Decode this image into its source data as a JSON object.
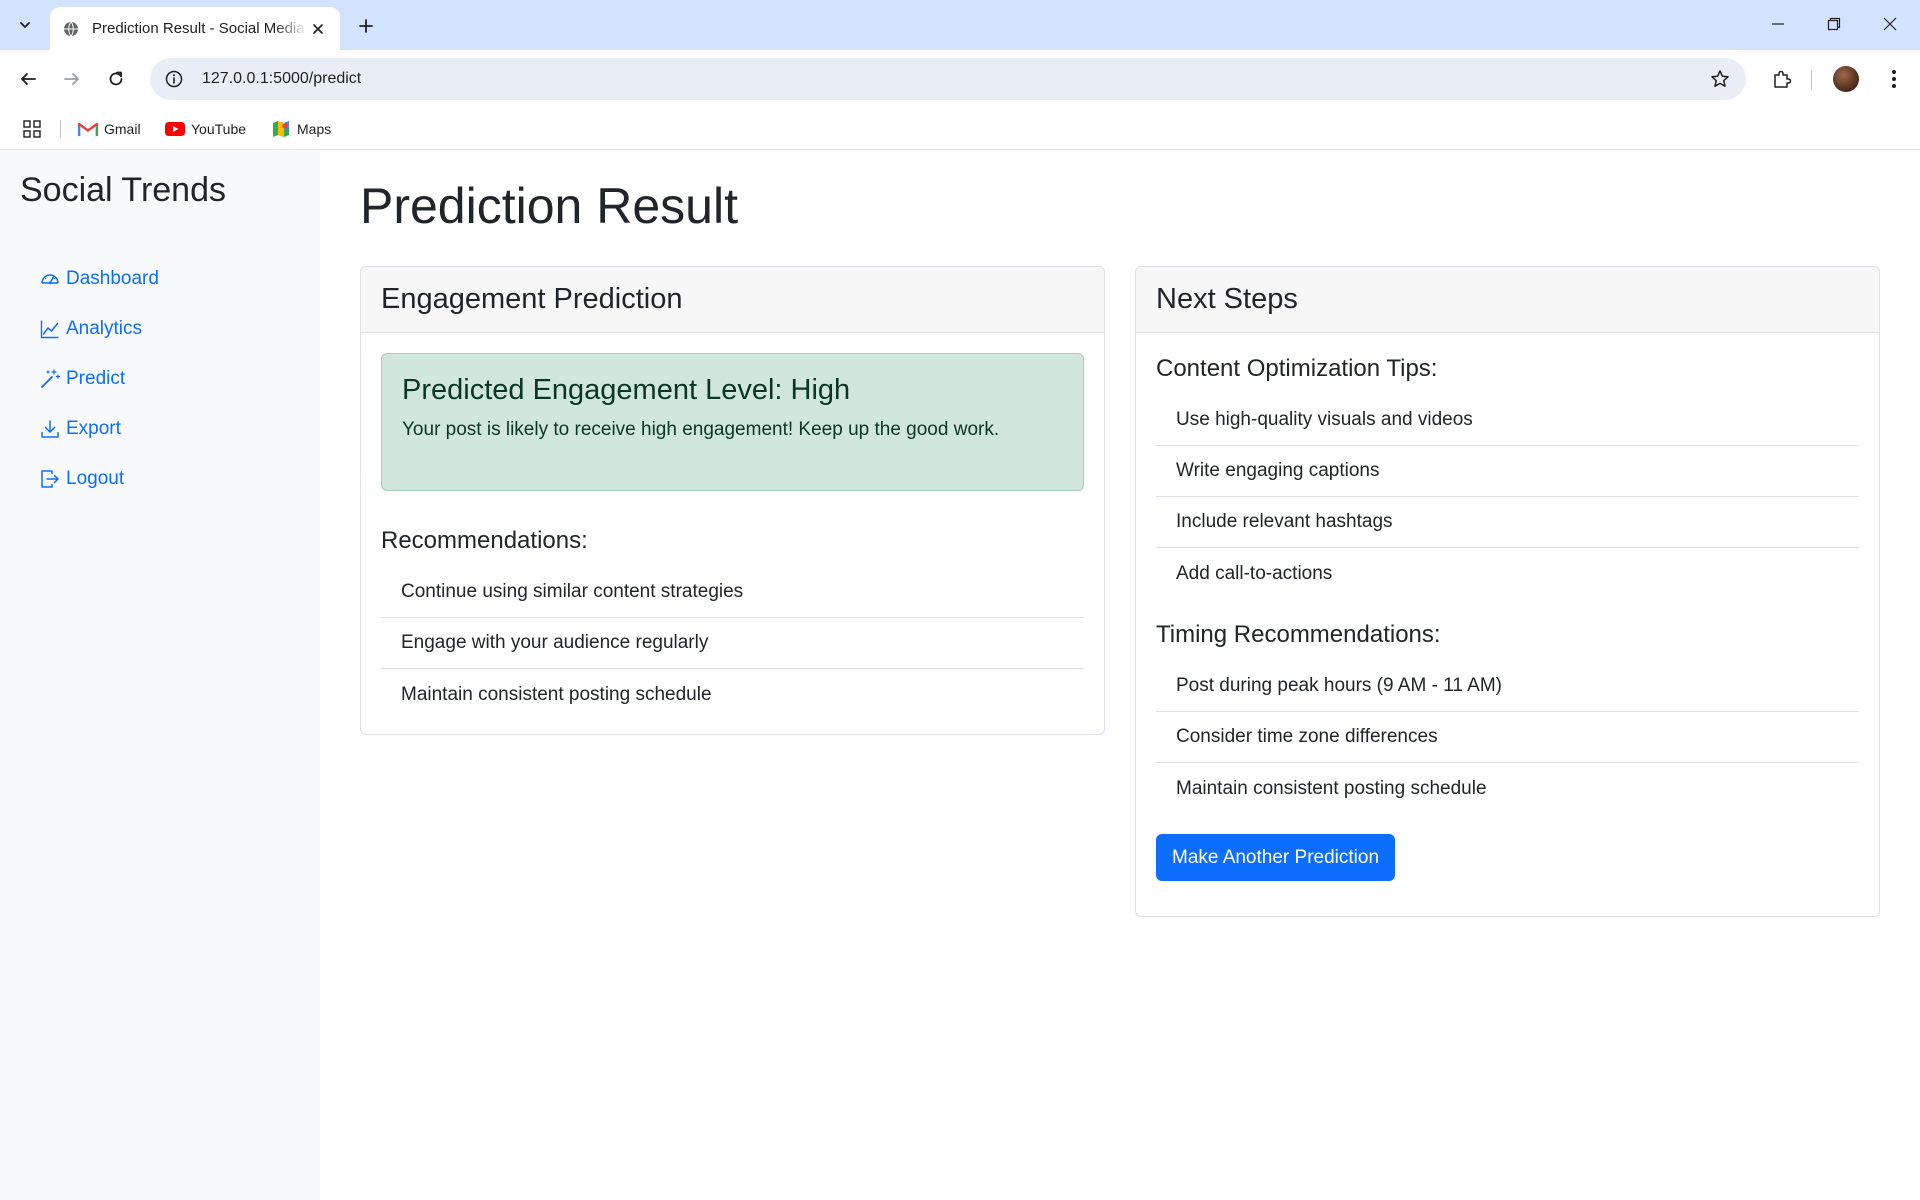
{
  "browser": {
    "tab_title": "Prediction Result - Social Media Trends",
    "url": "127.0.0.1:5000/predict",
    "bookmarks": [
      {
        "label": "Gmail",
        "icon": "gmail-icon"
      },
      {
        "label": "YouTube",
        "icon": "youtube-icon"
      },
      {
        "label": "Maps",
        "icon": "maps-icon"
      }
    ]
  },
  "sidebar": {
    "brand": "Social Trends",
    "items": [
      {
        "label": "Dashboard",
        "icon": "speedometer-icon"
      },
      {
        "label": "Analytics",
        "icon": "graph-up-icon"
      },
      {
        "label": "Predict",
        "icon": "magic-wand-icon"
      },
      {
        "label": "Export",
        "icon": "download-icon"
      },
      {
        "label": "Logout",
        "icon": "logout-icon"
      }
    ]
  },
  "page": {
    "title": "Prediction Result"
  },
  "prediction_card": {
    "header": "Engagement Prediction",
    "alert_heading": "Predicted Engagement Level: High",
    "alert_text": "Your post is likely to receive high engagement! Keep up the good work.",
    "recommendations_title": "Recommendations:",
    "recommendations": [
      "Continue using similar content strategies",
      "Engage with your audience regularly",
      "Maintain consistent posting schedule"
    ]
  },
  "next_steps_card": {
    "header": "Next Steps",
    "content_title": "Content Optimization Tips:",
    "content_tips": [
      "Use high-quality visuals and videos",
      "Write engaging captions",
      "Include relevant hashtags",
      "Add call-to-actions"
    ],
    "timing_title": "Timing Recommendations:",
    "timing_tips": [
      "Post during peak hours (9 AM - 11 AM)",
      "Consider time zone differences",
      "Maintain consistent posting schedule"
    ],
    "button_label": "Make Another Prediction"
  },
  "colors": {
    "primary": "#0d6efd",
    "success_bg": "#d1e7dd",
    "success_text": "#0a3622",
    "sidebar_bg": "#f8f9fa",
    "browser_frame": "#d3e3fd"
  }
}
